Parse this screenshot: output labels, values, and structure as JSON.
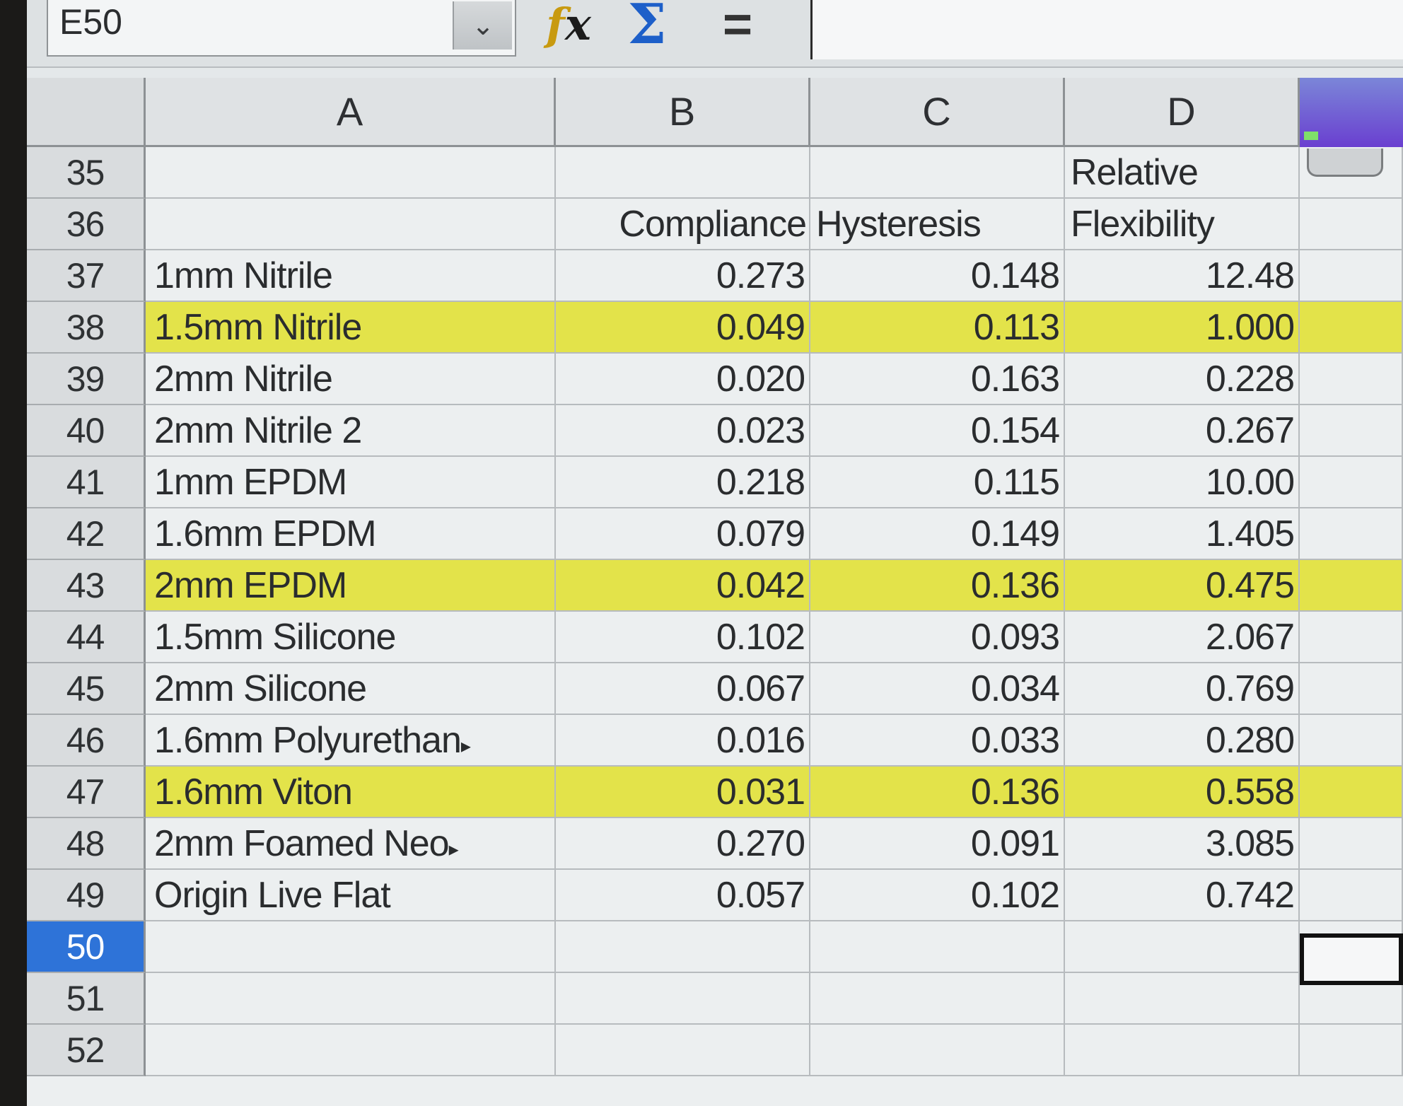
{
  "formula_bar": {
    "name_box": "E50",
    "function_wizard_icon": "fx",
    "sum_icon": "Σ",
    "equals_icon": "="
  },
  "columns": [
    {
      "label": "A"
    },
    {
      "label": "B"
    },
    {
      "label": "C"
    },
    {
      "label": "D"
    }
  ],
  "header_rows": {
    "r35": {
      "row": "35",
      "D": "Relative"
    },
    "r36": {
      "row": "36",
      "B": "Compliance",
      "C": "Hysteresis",
      "D": "Flexibility"
    }
  },
  "rows": [
    {
      "row": "37",
      "A": "1mm Nitrile",
      "B": "0.273",
      "C": "0.148",
      "D": "12.48",
      "highlight": false
    },
    {
      "row": "38",
      "A": "1.5mm Nitrile",
      "B": "0.049",
      "C": "0.113",
      "D": "1.000",
      "highlight": true
    },
    {
      "row": "39",
      "A": "2mm Nitrile",
      "B": "0.020",
      "C": "0.163",
      "D": "0.228",
      "highlight": false
    },
    {
      "row": "40",
      "A": "2mm Nitrile 2",
      "B": "0.023",
      "C": "0.154",
      "D": "0.267",
      "highlight": false
    },
    {
      "row": "41",
      "A": "1mm EPDM",
      "B": "0.218",
      "C": "0.115",
      "D": "10.00",
      "highlight": false
    },
    {
      "row": "42",
      "A": "1.6mm EPDM",
      "B": "0.079",
      "C": "0.149",
      "D": "1.405",
      "highlight": false
    },
    {
      "row": "43",
      "A": "2mm EPDM",
      "B": "0.042",
      "C": "0.136",
      "D": "0.475",
      "highlight": true
    },
    {
      "row": "44",
      "A": "1.5mm Silicone",
      "B": "0.102",
      "C": "0.093",
      "D": "2.067",
      "highlight": false
    },
    {
      "row": "45",
      "A": "2mm Silicone",
      "B": "0.067",
      "C": "0.034",
      "D": "0.769",
      "highlight": false
    },
    {
      "row": "46",
      "A": "1.6mm Polyurethan",
      "B": "0.016",
      "C": "0.033",
      "D": "0.280",
      "highlight": false,
      "overflow": "▸"
    },
    {
      "row": "47",
      "A": "1.6mm Viton",
      "B": "0.031",
      "C": "0.136",
      "D": "0.558",
      "highlight": true
    },
    {
      "row": "48",
      "A": "2mm Foamed Neo",
      "B": "0.270",
      "C": "0.091",
      "D": "3.085",
      "highlight": false,
      "overflow": "▸"
    },
    {
      "row": "49",
      "A": "Origin Live Flat",
      "B": "0.057",
      "C": "0.102",
      "D": "0.742",
      "highlight": false
    }
  ],
  "empty_rows": [
    {
      "row": "50",
      "selected": true
    },
    {
      "row": "51",
      "selected": false
    },
    {
      "row": "52",
      "selected": false
    }
  ],
  "colors": {
    "highlight": "#e3e34a",
    "selected_row_header": "#2e73d8",
    "selected_column_header": "#6a3fd0"
  }
}
